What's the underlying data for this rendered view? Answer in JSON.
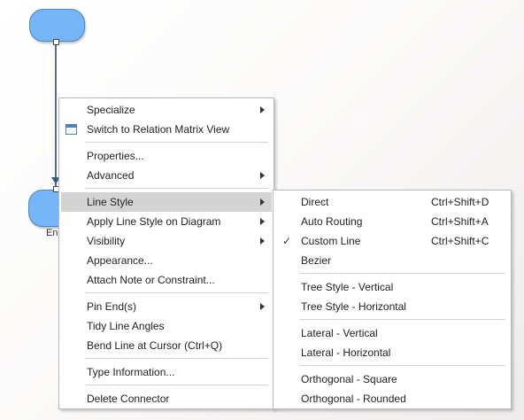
{
  "diagram": {
    "bottom_node_label": "En"
  },
  "context_menu": {
    "items": [
      {
        "label": "Specialize",
        "submenu": true
      },
      {
        "label": "Switch to Relation Matrix View",
        "icon": "relation-matrix-icon"
      },
      {
        "label": "Properties..."
      },
      {
        "label": "Advanced",
        "submenu": true
      },
      {
        "label": "Line Style",
        "submenu": true,
        "highlighted": true
      },
      {
        "label": "Apply Line Style on Diagram",
        "submenu": true
      },
      {
        "label": "Visibility",
        "submenu": true
      },
      {
        "label": "Appearance..."
      },
      {
        "label": "Attach Note or Constraint..."
      },
      {
        "label": "Pin End(s)",
        "submenu": true
      },
      {
        "label": "Tidy Line Angles"
      },
      {
        "label": "Bend Line at Cursor (Ctrl+Q)"
      },
      {
        "label": "Type Information..."
      },
      {
        "label": "Delete Connector"
      }
    ]
  },
  "line_style_submenu": {
    "items": [
      {
        "label": "Direct",
        "shortcut": "Ctrl+Shift+D"
      },
      {
        "label": "Auto Routing",
        "shortcut": "Ctrl+Shift+A"
      },
      {
        "label": "Custom Line",
        "shortcut": "Ctrl+Shift+C",
        "checked": true,
        "check_glyph": "✓"
      },
      {
        "label": "Bezier"
      },
      {
        "label": "Tree Style - Vertical"
      },
      {
        "label": "Tree Style - Horizontal"
      },
      {
        "label": "Lateral - Vertical"
      },
      {
        "label": "Lateral - Horizontal"
      },
      {
        "label": "Orthogonal - Square"
      },
      {
        "label": "Orthogonal - Rounded"
      }
    ]
  },
  "colors": {
    "node_fill": "#74b6f7",
    "highlight": "#d3d3d3",
    "menu_bg": "#ffffff"
  }
}
